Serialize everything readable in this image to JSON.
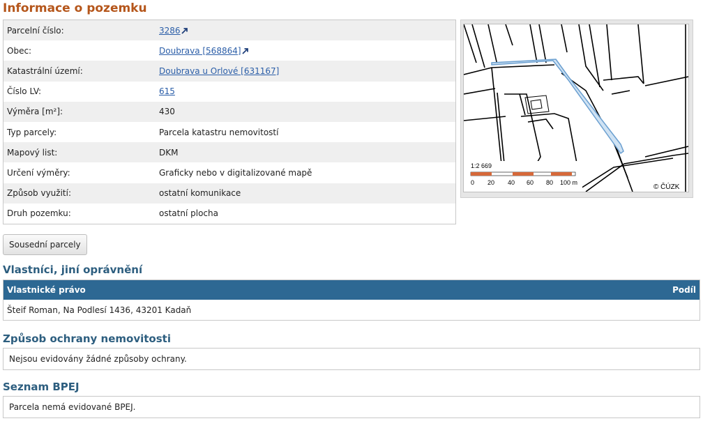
{
  "title": "Informace o pozemku",
  "info_rows": [
    {
      "label": "Parcelní číslo:",
      "value": "3286",
      "link": true,
      "external": true
    },
    {
      "label": "Obec:",
      "value": "Doubrava [568864]",
      "link": true,
      "external": true
    },
    {
      "label": "Katastrální území:",
      "value": "Doubrava u Orlové [631167]",
      "link": true,
      "external": false
    },
    {
      "label": "Číslo LV:",
      "value": "615",
      "link": true,
      "external": false
    },
    {
      "label": "Výměra [m²]:",
      "value": "430",
      "link": false,
      "external": false
    },
    {
      "label": "Typ parcely:",
      "value": "Parcela katastru nemovitostí",
      "link": false,
      "external": false
    },
    {
      "label": "Mapový list:",
      "value": "DKM",
      "link": false,
      "external": false
    },
    {
      "label": "Určení výměry:",
      "value": "Graficky nebo v digitalizované mapě",
      "link": false,
      "external": false
    },
    {
      "label": "Způsob využití:",
      "value": "ostatní komunikace",
      "link": false,
      "external": false
    },
    {
      "label": "Druh pozemku:",
      "value": "ostatní plocha",
      "link": false,
      "external": false
    }
  ],
  "map": {
    "scale_text": "1:2 669",
    "scale_ticks": [
      "0",
      "20",
      "40",
      "60",
      "80",
      "100 m"
    ],
    "copyright": "© ČÚZK"
  },
  "neighbors_button": "Sousední parcely",
  "owners": {
    "heading": "Vlastníci, jiní oprávnění",
    "col_right": "Vlastnické právo",
    "col_share": "Podíl",
    "rows": [
      "Šteif Roman, Na Podlesí 1436, 43201 Kadaň"
    ]
  },
  "protection": {
    "heading": "Způsob ochrany nemovitosti",
    "text": "Nejsou evidovány žádné způsoby ochrany."
  },
  "bpej": {
    "heading": "Seznam BPEJ",
    "text": "Parcela nemá evidované BPEJ."
  },
  "colors": {
    "title": "#b5561b",
    "section_heading": "#2d5e7f",
    "table_header": "#2d6893",
    "link": "#2b5ea8",
    "parcel_highlight": "#6a9fd0",
    "scale_bar": "#d6693a"
  }
}
